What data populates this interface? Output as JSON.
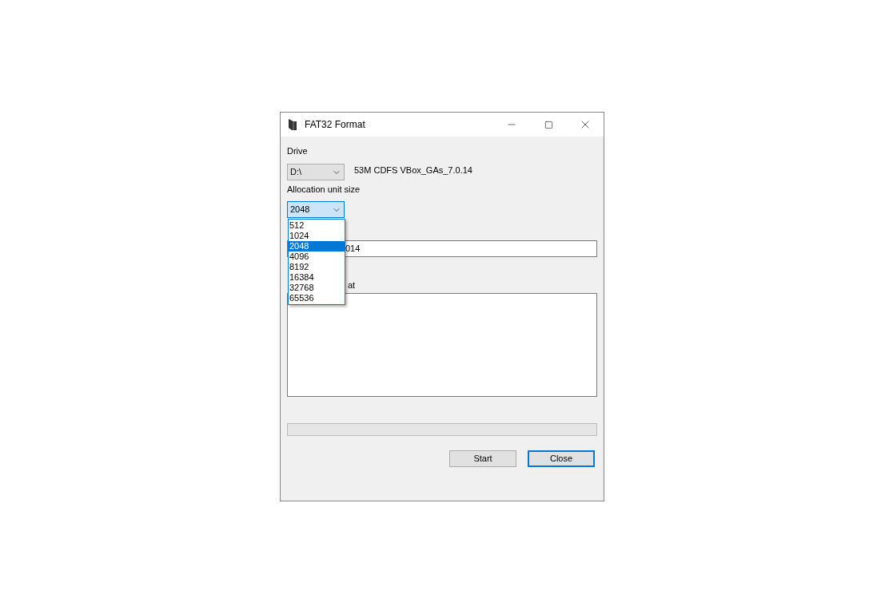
{
  "window": {
    "title": "FAT32 Format"
  },
  "drive": {
    "label": "Drive",
    "value": "D:\\",
    "info": "53M CDFS VBox_GAs_7.0.14"
  },
  "allocation": {
    "label": "Allocation unit size",
    "value": "2048",
    "open": true,
    "options": [
      {
        "label": "512",
        "selected": false
      },
      {
        "label": "1024",
        "selected": false
      },
      {
        "label": "2048",
        "selected": true
      },
      {
        "label": "4096",
        "selected": false
      },
      {
        "label": "8192",
        "selected": false
      },
      {
        "label": "16384",
        "selected": false
      },
      {
        "label": "32768",
        "selected": false
      },
      {
        "label": "65536",
        "selected": false
      }
    ]
  },
  "volume_label": {
    "value": "014"
  },
  "log": {
    "label": "at"
  },
  "progress": {
    "level": 0
  },
  "buttons": [
    {
      "label": "Start",
      "focused": false
    },
    {
      "label": "Close",
      "focused": true
    }
  ]
}
